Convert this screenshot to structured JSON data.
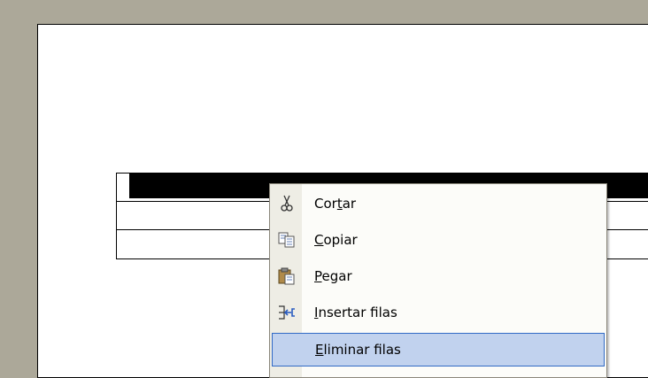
{
  "menu": {
    "items": [
      {
        "pre": "Cor",
        "key": "t",
        "post": "ar",
        "icon": "scissors-icon"
      },
      {
        "pre": "",
        "key": "C",
        "post": "opiar",
        "icon": "copy-icon"
      },
      {
        "pre": "",
        "key": "P",
        "post": "egar",
        "icon": "paste-icon"
      },
      {
        "pre": "",
        "key": "I",
        "post": "nsertar filas",
        "icon": "insert-rows-icon"
      },
      {
        "pre": "",
        "key": "E",
        "post": "liminar filas",
        "icon": "none",
        "highlighted": true
      }
    ]
  },
  "colors": {
    "workspace": "#aca899",
    "menu_highlight": "#c1d2ee",
    "menu_highlight_border": "#316ac5",
    "menu_gutter": "#eeede5"
  }
}
